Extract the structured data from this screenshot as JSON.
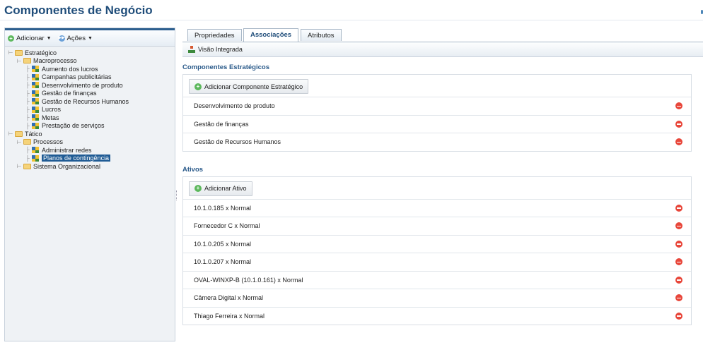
{
  "page": {
    "title": "Componentes de Negócio"
  },
  "toolbar": {
    "add_label": "Adicionar",
    "actions_label": "Ações"
  },
  "tree": [
    {
      "label": "Estratégico",
      "type": "folder",
      "level": 0
    },
    {
      "label": "Macroprocesso",
      "type": "folder",
      "level": 1
    },
    {
      "label": "Aumento dos lucros",
      "type": "component",
      "level": 2
    },
    {
      "label": "Campanhas publicitárias",
      "type": "component",
      "level": 2
    },
    {
      "label": "Desenvolvimento de produto",
      "type": "component",
      "level": 2
    },
    {
      "label": "Gestão de finanças",
      "type": "component",
      "level": 2
    },
    {
      "label": "Gestão de Recursos Humanos",
      "type": "component",
      "level": 2
    },
    {
      "label": "Lucros",
      "type": "component",
      "level": 2
    },
    {
      "label": "Metas",
      "type": "component",
      "level": 2
    },
    {
      "label": "Prestação de serviços",
      "type": "component",
      "level": 2
    },
    {
      "label": "Tático",
      "type": "folder",
      "level": 0
    },
    {
      "label": "Processos",
      "type": "folder",
      "level": 1
    },
    {
      "label": "Administrar redes",
      "type": "component",
      "level": 2
    },
    {
      "label": "Planos de contingência",
      "type": "component",
      "level": 2,
      "selected": true
    },
    {
      "label": "Sistema Organizacional",
      "type": "folder",
      "level": 1
    }
  ],
  "tabs": [
    {
      "label": "Propriedades",
      "active": false
    },
    {
      "label": "Associações",
      "active": true
    },
    {
      "label": "Atributos",
      "active": false
    }
  ],
  "subtoolbar": {
    "view_label": "Visão Integrada"
  },
  "strategic": {
    "title": "Componentes Estratégicos",
    "add_label": "Adicionar Componente Estratégico",
    "items": [
      "Desenvolvimento de produto",
      "Gestão de finanças",
      "Gestão de Recursos Humanos"
    ]
  },
  "assets": {
    "title": "Ativos",
    "add_label": "Adicionar Ativo",
    "items": [
      "10.1.0.185 x Normal",
      "Fornecedor C x Normal",
      "10.1.0.205 x Normal",
      "10.1.0.207 x Normal",
      "OVAL-WINXP-B (10.1.0.161) x Normal",
      "Câmera Digital x Normal",
      "Thiago Ferreira x Normal"
    ]
  }
}
